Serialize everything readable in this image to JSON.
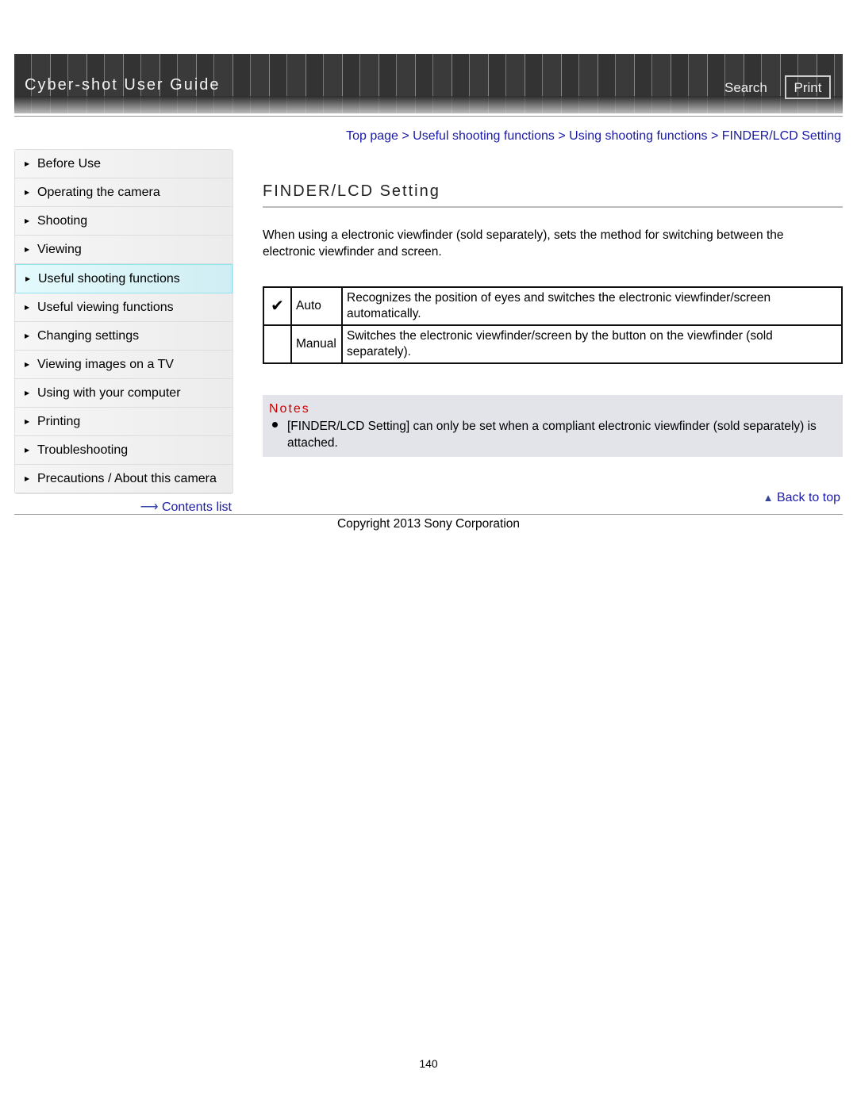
{
  "header": {
    "title": "Cyber-shot User Guide",
    "search": "Search",
    "print": "Print"
  },
  "breadcrumb": [
    "Top page",
    "Useful shooting functions",
    "Using shooting functions",
    "FINDER/LCD Setting"
  ],
  "sidebar": {
    "items": [
      "Before Use",
      "Operating the camera",
      "Shooting",
      "Viewing",
      "Useful shooting functions",
      "Useful viewing functions",
      "Changing settings",
      "Viewing images on a TV",
      "Using with your computer",
      "Printing",
      "Troubleshooting",
      "Precautions / About this camera"
    ],
    "selected": 4,
    "contents_link": "Contents list"
  },
  "main": {
    "title": "FINDER/LCD Setting",
    "intro": "When using a electronic viewfinder (sold separately), sets the method for switching between the electronic viewfinder and screen.",
    "options": [
      {
        "default": true,
        "name": "Auto",
        "desc": "Recognizes the position of eyes and switches the electronic viewfinder/screen automatically."
      },
      {
        "default": false,
        "name": "Manual",
        "desc": "Switches the electronic viewfinder/screen by the button on the viewfinder (sold separately)."
      }
    ],
    "notes_title": "Notes",
    "notes": [
      "[FINDER/LCD Setting] can only be set when a compliant electronic viewfinder (sold separately) is attached."
    ],
    "back_to_top": "Back to top"
  },
  "footer": {
    "copyright": "Copyright 2013 Sony Corporation",
    "page": "140"
  }
}
